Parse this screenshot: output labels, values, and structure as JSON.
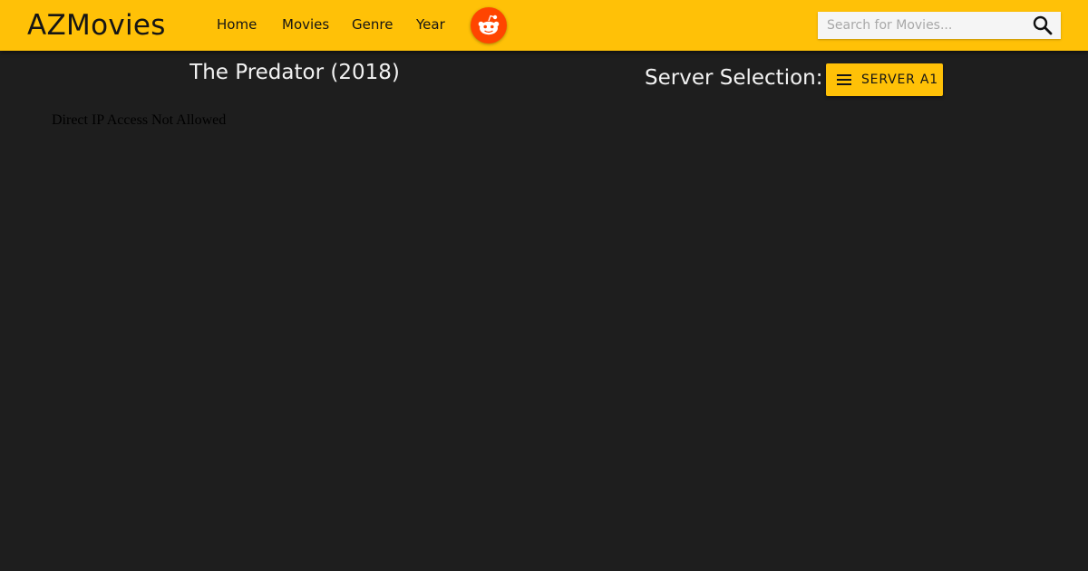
{
  "header": {
    "brand": "AZMovies",
    "nav": [
      {
        "label": "Home"
      },
      {
        "label": "Movies"
      },
      {
        "label": "Genre"
      },
      {
        "label": "Year"
      }
    ],
    "social_icon": "reddit-icon",
    "search": {
      "placeholder": "Search for Movies...",
      "value": "",
      "icon": "search-icon"
    }
  },
  "main": {
    "title": "The Predator (2018)",
    "server_label": "Server Selection:",
    "server_button": {
      "label": "SERVER A1",
      "icon": "menu-icon"
    },
    "player_message": "Direct IP Access Not Allowed"
  },
  "colors": {
    "accent": "#ffc107",
    "background": "#1e1e1e",
    "reddit": "#ff4500",
    "text_light": "#f2f2f2"
  }
}
